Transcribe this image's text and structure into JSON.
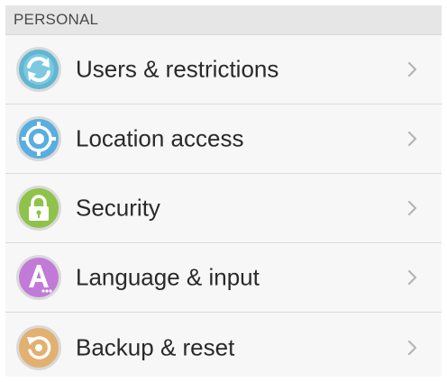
{
  "section": {
    "title": "PERSONAL"
  },
  "items": [
    {
      "label": "Users & restrictions",
      "icon": "users-sync-icon",
      "color": "#5fb7d3"
    },
    {
      "label": "Location access",
      "icon": "location-icon",
      "color": "#58aee0"
    },
    {
      "label": "Security",
      "icon": "lock-icon",
      "color": "#8fc24a"
    },
    {
      "label": "Language & input",
      "icon": "language-a-icon",
      "color": "#c27ad8"
    },
    {
      "label": "Backup & reset",
      "icon": "backup-icon",
      "color": "#e2b070"
    }
  ],
  "colors": {
    "background": "#f7f7f7",
    "header_bg": "#e6e6e6",
    "divider": "#dcdcdc",
    "chevron": "#b5b5b5"
  }
}
